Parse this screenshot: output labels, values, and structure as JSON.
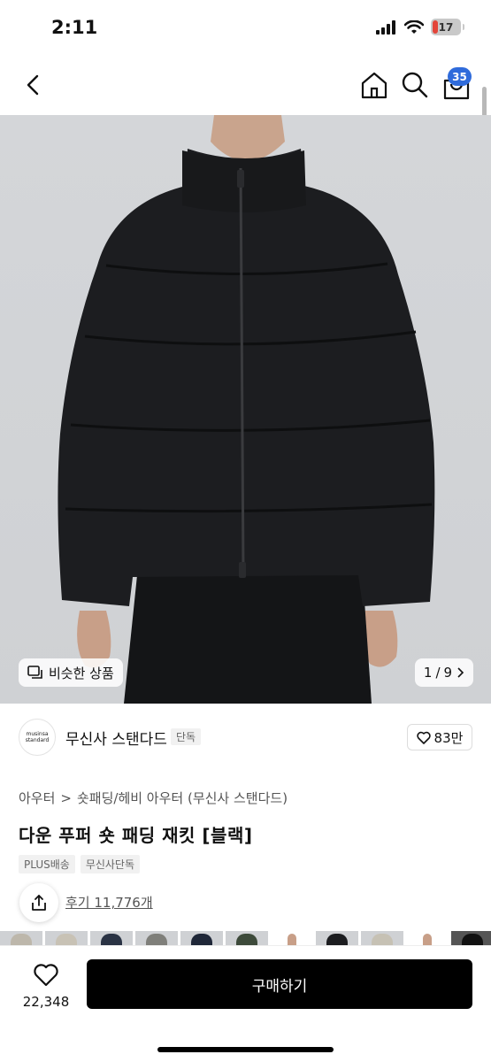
{
  "status_bar": {
    "time": "2:11",
    "battery": "17"
  },
  "nav": {
    "cart_count": "35"
  },
  "hero": {
    "similar_label": "비슷한 상품",
    "page_current": "1",
    "page_sep": "/",
    "page_total": "9"
  },
  "brand": {
    "logo_line1": "musinsa",
    "logo_line2": "standard",
    "name": "무신사 스탠다드",
    "tag": "단독",
    "likes": "83만"
  },
  "product": {
    "category_root": "아우터",
    "category_sep": ">",
    "category_path": "숏패딩/헤비 아우터 (무신사 스탠다드)",
    "title": "다운 푸퍼 숏 패딩 재킷 [블랙]",
    "tags": [
      "PLUS배송",
      "무신사단독"
    ],
    "reviews": "후기 11,776개"
  },
  "bottom_bar": {
    "wish_count": "22,348",
    "buy_label": "구매하기"
  },
  "colors": {
    "accent_blue": "#2f6bdb",
    "battery_low": "#e3453a",
    "buy_button": "#000000"
  }
}
